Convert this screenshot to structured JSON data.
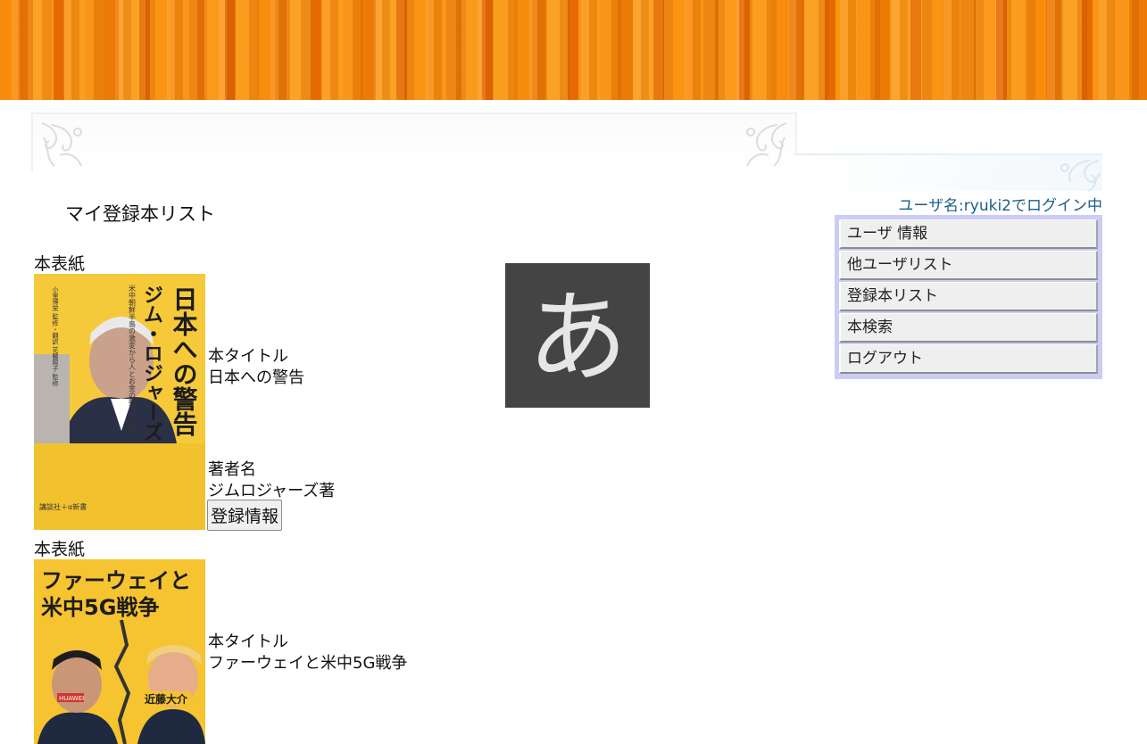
{
  "page": {
    "title": "マイ登録本リスト",
    "login_status": "ユーザ名:ryuki2でログイン中"
  },
  "menu": {
    "items": [
      {
        "label": "ユーザ 情報"
      },
      {
        "label": "他ユーザリスト"
      },
      {
        "label": "登録本リスト"
      },
      {
        "label": "本検索"
      },
      {
        "label": "ログアウト"
      }
    ]
  },
  "books": [
    {
      "cover_label": "本表紙",
      "title_label": "本タイトル",
      "title": "日本への警告",
      "author_label": "著者名",
      "author": "ジムロジャーズ著",
      "button_label": "登録情報",
      "cover_text": {
        "main": "日本への警告",
        "author": "ジム・ロジャーズ",
        "subtitle": "米中朝鮮半島の激変から人とお金の動きを見抜く",
        "translator": "小里博栄 監修・翻訳 花輪陽子 監修",
        "publisher": "講談社＋α新書"
      }
    },
    {
      "cover_label": "本表紙",
      "title_label": "本タイトル",
      "title": "ファーウェイと米中5G戦争",
      "cover_text": {
        "line1": "ファーウェイと",
        "line2": "米中5G戦争",
        "author": "近藤大介",
        "badge": "HUAWEI"
      }
    }
  ],
  "ime_indicator": "あ",
  "colors": {
    "banner": "#f88c0c",
    "menu_bg": "#ccccf6",
    "login_text": "#1a5e86",
    "ime_bg": "#444444",
    "cover1_bg": "#f2c12e",
    "cover2_bg": "#f6c331"
  }
}
